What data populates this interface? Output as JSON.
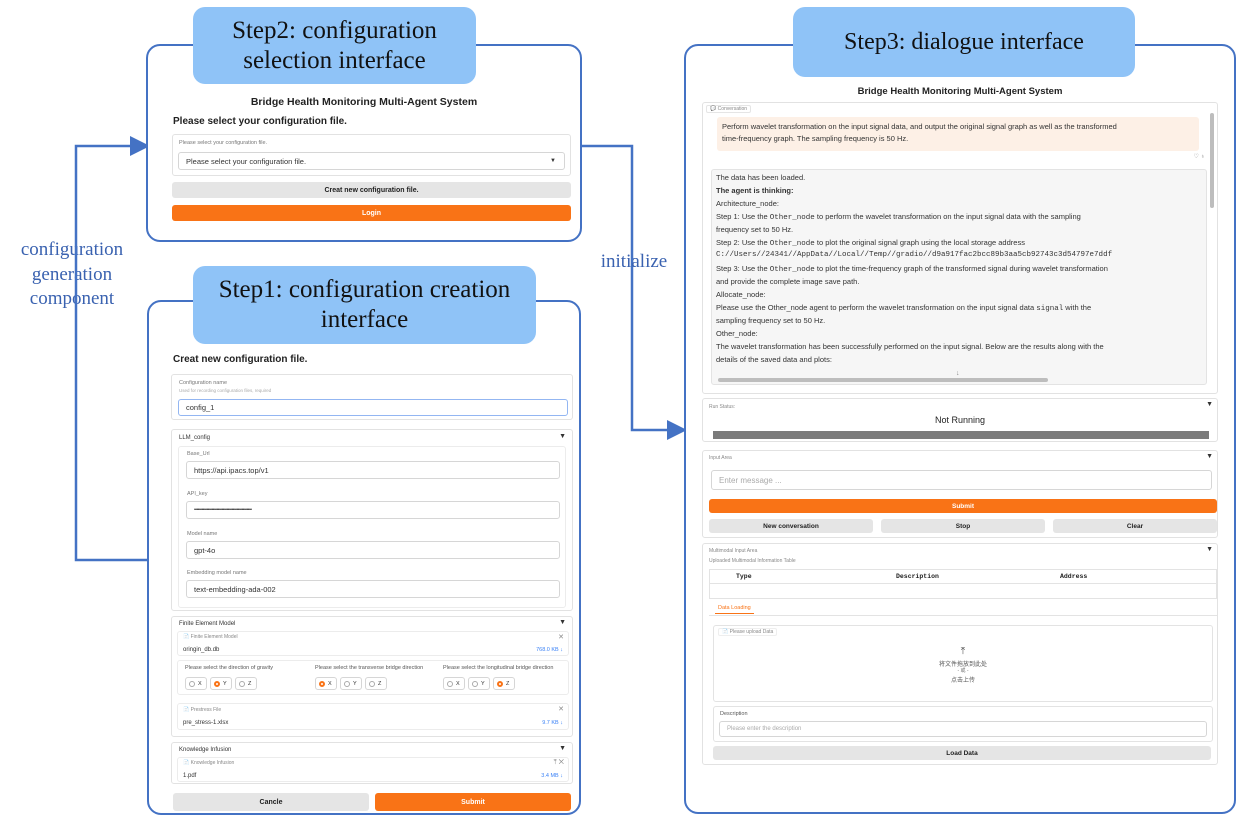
{
  "callouts": {
    "step2": [
      "Step2: configuration",
      "selection interface"
    ],
    "step1": [
      "Step1: configuration creation",
      "interface"
    ],
    "step3": "Step3: dialogue interface"
  },
  "flow_labels": {
    "left": [
      "configuration",
      "generation",
      "component"
    ],
    "right": "initialize"
  },
  "step2_ui": {
    "system_title": "Bridge Health Monitoring Multi-Agent System",
    "heading": "Please select your configuration file.",
    "field_label": "Please select your configuration file.",
    "dropdown_value": "Please select your configuration file.",
    "create_button": "Creat new configuration file.",
    "login_button": "Login"
  },
  "step1_ui": {
    "heading": "Creat new configuration file.",
    "config_name_label": "Configuration name",
    "config_name_hint": "Used for recording configuration files, required",
    "config_name_value": "config_1",
    "llm_section": "LLM_config",
    "base_url_label": "Base_Url",
    "base_url_value": "https://api.ipacs.top/v1",
    "api_key_label": "API_key",
    "api_key_value": "••••••••••••••••••••••••••••••••••••••••••••••",
    "model_name_label": "Model name",
    "model_name_value": "gpt-4o",
    "embedding_label": "Embedding model name",
    "embedding_value": "text-embedding-ada-002",
    "fem_section": "Finite Element Model",
    "fem_file_label": "Finite Element Model",
    "fem_file_name": "oringin_db.db",
    "fem_file_size": "768.0 KB ↓",
    "gravity_label": "Please select the direction of gravity",
    "transverse_label": "Please select the transverse bridge direction",
    "longitudinal_label": "Please select the longitudinal bridge direction",
    "axes": [
      "X",
      "Y",
      "Z"
    ],
    "prestress_label": "Prestress File",
    "prestress_file": "pre_stress-1.xlsx",
    "prestress_size": "9.7 KB ↓",
    "knowledge_section": "Knowledge Infusion",
    "knowledge_label": "Knowledge Infusion",
    "knowledge_file": "1.pdf",
    "knowledge_size": "3.4 MB ↓",
    "cancel_button": "Cancle",
    "submit_button": "Submit"
  },
  "step3_ui": {
    "system_title": "Bridge Health Monitoring Multi-Agent System",
    "conversation_label": "Conversation",
    "user_message": [
      "Perform wavelet transformation on the input signal data, and output the original signal graph as well as the transformed",
      "time-frequency graph. The sampling frequency is 50 Hz."
    ],
    "reply": {
      "loaded": "The data has been loaded.",
      "thinking": "The agent is thinking:",
      "arch": "Architecture_node:",
      "step1a": "Step 1: Use the ",
      "node": "Other_node",
      "step1b": " to perform the wavelet transformation on the input signal data with the sampling",
      "step1c": "frequency set to 50 Hz.",
      "step2a": "Step 2: Use the ",
      "step2b": " to plot the original signal graph using the local storage address",
      "path": "C://Users//24341//AppData//Local//Temp//gradio//d9a917fac2bcc89b3aa5cb92743c3d54797e7ddf",
      "step3a": "Step 3: Use the ",
      "step3b": " to plot the time-frequency graph of the transformed signal during wavelet transformation",
      "step3c": "and provide the complete image save path.",
      "allocate": "Allocate_node:",
      "alloc_text_a": "Please use the Other_node agent to perform the wavelet transformation on the input signal data ",
      "alloc_signal": "signal",
      "alloc_text_b": " with the",
      "alloc_text_c": "sampling frequency set to 50 Hz.",
      "other": "Other_node:",
      "other_text_a": "The wavelet transformation has been successfully performed on the input signal. Below are the results along with the",
      "other_text_b": "details of the saved data and plots:"
    },
    "run_status_label": "Run Status:",
    "run_status_value": "Not Running",
    "input_area_label": "Input Area",
    "input_placeholder": "Enter message ...",
    "submit_button": "Submit",
    "new_conv_button": "New conversation",
    "stop_button": "Stop",
    "clear_button": "Clear",
    "multimodal_label": "Multimodal Input Area",
    "table_title": "Uploaded Multimodal Information Table",
    "table_headers": [
      "Type",
      "Description",
      "Address"
    ],
    "tab_label": "Data Loading",
    "upload_label": "Please upload Data",
    "upload_text_1": "将文件拖放到此处",
    "upload_text_2": "- 或 -",
    "upload_text_3": "点击上传",
    "description_label": "Description",
    "description_placeholder": "Please enter the description",
    "load_button": "Load Data"
  },
  "colors": {
    "frame": "#4472c4",
    "callout": "#8fc3f7",
    "accent": "#f97316"
  }
}
